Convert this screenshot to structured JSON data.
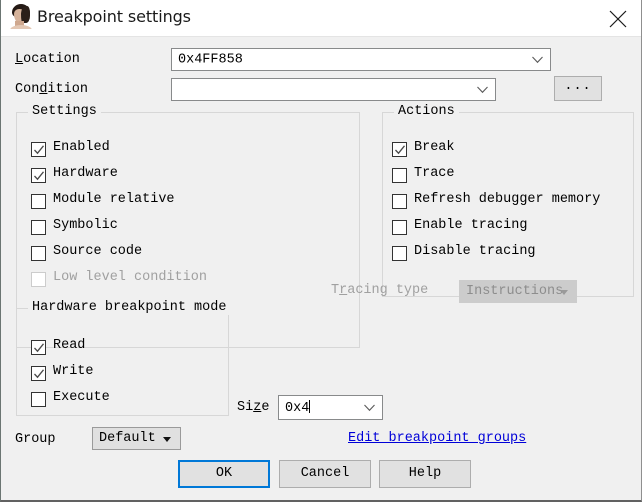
{
  "window": {
    "title": "Breakpoint settings",
    "icon": "person-avatar-icon",
    "close_label": "✕",
    "accent_color": "#0078d7",
    "link_color": "#0000d8",
    "background": "#f0f0f0"
  },
  "fields": {
    "location": {
      "label": "Location",
      "accel": "L",
      "value": "0x4FF858"
    },
    "condition": {
      "label": "Condition",
      "accel": "d",
      "value": ""
    },
    "browse_button": "..."
  },
  "settings_group": {
    "title": "Settings",
    "items": [
      {
        "label": "Enabled",
        "checked": true,
        "disabled": false
      },
      {
        "label": "Hardware",
        "checked": true,
        "disabled": false
      },
      {
        "label": "Module relative",
        "checked": false,
        "disabled": false
      },
      {
        "label": "Symbolic",
        "checked": false,
        "disabled": false
      },
      {
        "label": "Source code",
        "checked": false,
        "disabled": false
      },
      {
        "label": "Low level condition",
        "checked": false,
        "disabled": true
      }
    ]
  },
  "actions_group": {
    "title": "Actions",
    "items": [
      {
        "label": "Break",
        "checked": true,
        "disabled": false
      },
      {
        "label": "Trace",
        "checked": false,
        "disabled": false
      },
      {
        "label": "Refresh debugger memory",
        "checked": false,
        "disabled": false
      },
      {
        "label": "Enable tracing",
        "checked": false,
        "disabled": false
      },
      {
        "label": "Disable tracing",
        "checked": false,
        "disabled": false
      }
    ]
  },
  "tracing_type": {
    "label": "Tracing type",
    "accel": "r",
    "value": "Instructions",
    "disabled": true
  },
  "hardware_group": {
    "title": "Hardware breakpoint mode",
    "items": [
      {
        "label": "Read",
        "checked": true,
        "disabled": false
      },
      {
        "label": "Write",
        "checked": true,
        "disabled": false
      },
      {
        "label": "Execute",
        "checked": false,
        "disabled": false
      }
    ]
  },
  "size": {
    "label": "Size",
    "accel": "z",
    "value": "0x4"
  },
  "group": {
    "label": "Group",
    "value": "Default"
  },
  "edit_groups_link": "Edit breakpoint groups",
  "buttons": {
    "ok": "OK",
    "cancel": "Cancel",
    "help": "Help"
  }
}
